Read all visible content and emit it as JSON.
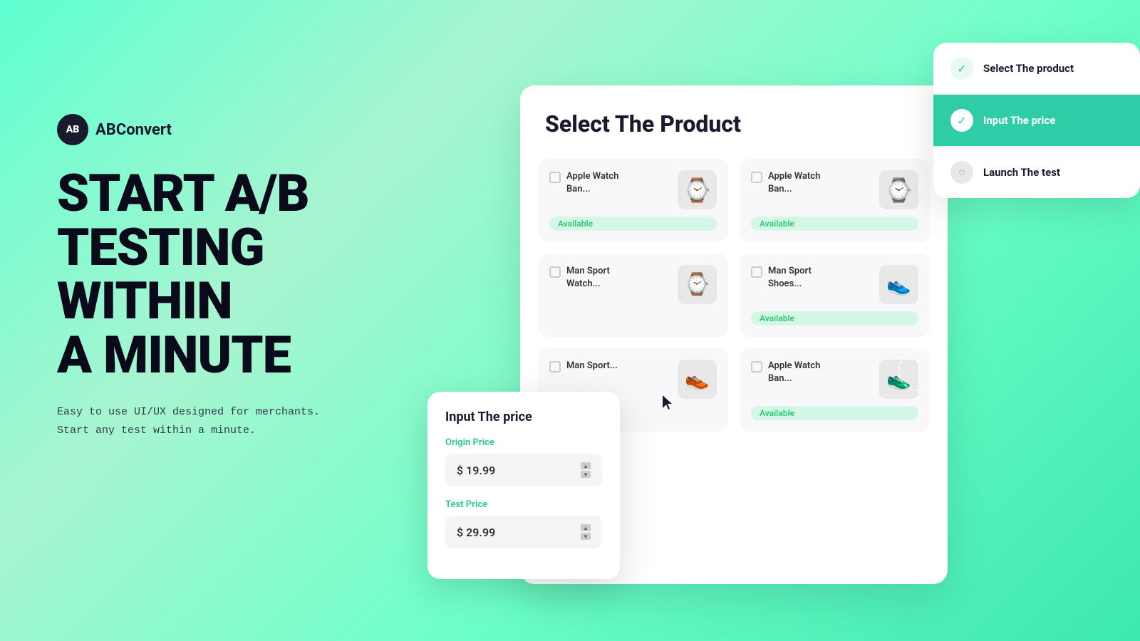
{
  "logo": {
    "icon_text": "AB",
    "name": "ABConvert"
  },
  "headline": {
    "line1": "START A/B",
    "line2": "TESTING",
    "line3": "WITHIN",
    "line4": "A MINUTE"
  },
  "subtext": {
    "line1": "Easy to use UI/UX designed for merchants.",
    "line2": "Start any test within a minute."
  },
  "product_card": {
    "title": "Select The  Product",
    "products": [
      {
        "name": "Apple Watch\nBan...",
        "status": "Available",
        "emoji": "⌚"
      },
      {
        "name": "Apple Watch\nBan...",
        "status": "Available",
        "emoji": "⌚"
      },
      {
        "name": "Man Sport\nWatch...",
        "status": "",
        "emoji": "⌚"
      },
      {
        "name": "Man Sport\nShoes...",
        "status": "Available",
        "emoji": "👟"
      },
      {
        "name": "Man Sport...",
        "status": "",
        "emoji": "👟"
      },
      {
        "name": "Apple Watch\nBan...",
        "status": "Available",
        "emoji": "👟"
      }
    ]
  },
  "price_card": {
    "title": "Input The price",
    "origin_label": "Origin Price",
    "origin_value": "$ 19.99",
    "test_label": "Test Price",
    "test_value": "$ 29.99"
  },
  "steps": [
    {
      "label": "Select The product",
      "state": "done"
    },
    {
      "label": "Input The price",
      "state": "active"
    },
    {
      "label": "Launch The test",
      "state": "pending"
    }
  ],
  "colors": {
    "teal": "#2ecda8",
    "teal_light": "#d4f7ee",
    "dark": "#1a1a2e"
  }
}
